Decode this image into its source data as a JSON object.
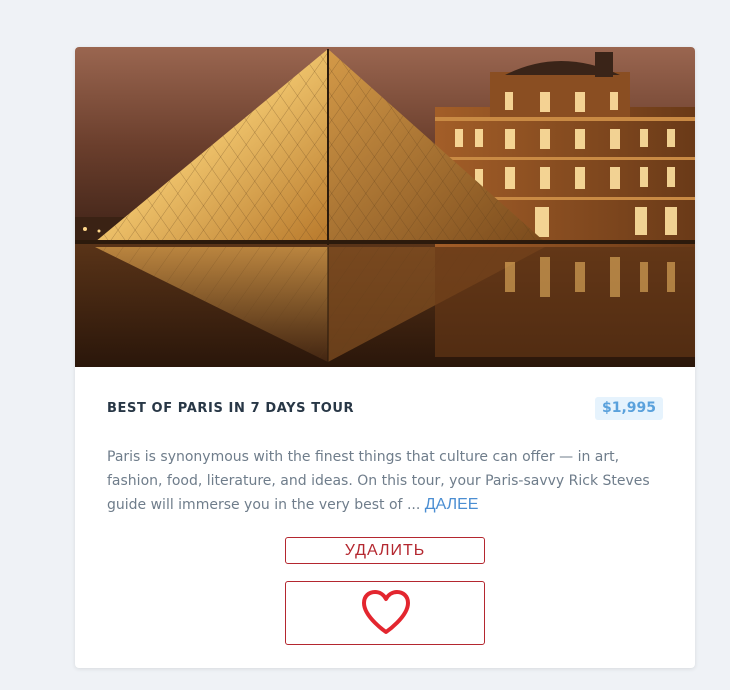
{
  "card": {
    "image_icon": "louvre-pyramid-night-photo",
    "title": "BEST OF PARIS IN 7 DAYS TOUR",
    "price": "$1,995",
    "description": "Paris is synonymous with the finest things that culture can offer — in art, fashion, food, literature, and ideas. On this tour, your Paris-savvy Rick Steves guide will immerse you in the very best of ...",
    "more_link": "ДАЛЕЕ",
    "delete_label": "УДАЛИТЬ",
    "favorite_icon": "heart-icon"
  },
  "colors": {
    "page_background": "#eff2f6",
    "title_text": "#283746",
    "price_text": "#5aa1dc",
    "price_background": "#e6f3fd",
    "description_text": "#6f7d8b",
    "link": "#4b8ed2",
    "danger": "#b4272f",
    "heart": "#e3262f"
  }
}
